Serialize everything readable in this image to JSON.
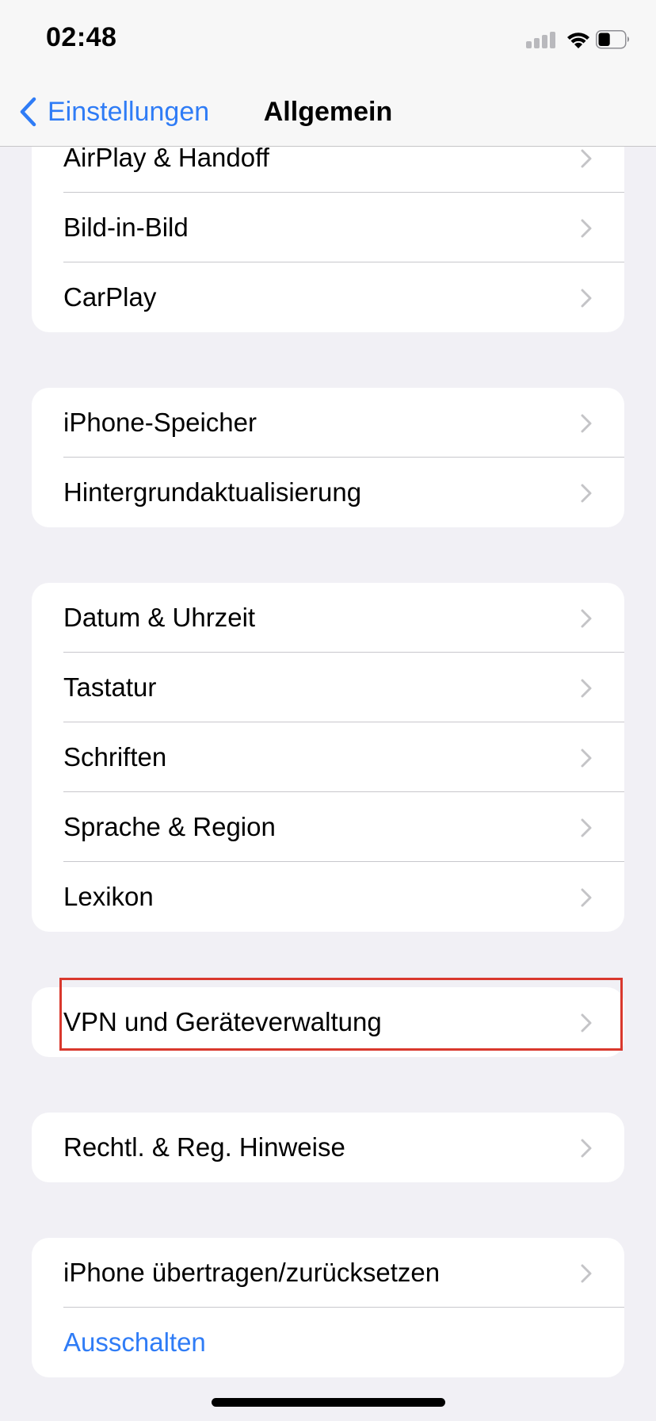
{
  "status_bar": {
    "time": "02:48",
    "signal_icon": "cellular-signal-icon",
    "wifi_icon": "wifi-icon",
    "battery_icon": "battery-icon",
    "battery_level": 0.45
  },
  "nav": {
    "back_label": "Einstellungen",
    "back_icon": "chevron-left-icon",
    "title": "Allgemein"
  },
  "groups": [
    {
      "items": [
        {
          "label": "AirPlay & Handoff"
        },
        {
          "label": "Bild-in-Bild"
        },
        {
          "label": "CarPlay"
        }
      ]
    },
    {
      "items": [
        {
          "label": "iPhone-Speicher"
        },
        {
          "label": "Hintergrundaktualisierung"
        }
      ]
    },
    {
      "items": [
        {
          "label": "Datum & Uhrzeit"
        },
        {
          "label": "Tastatur"
        },
        {
          "label": "Schriften"
        },
        {
          "label": "Sprache & Region"
        },
        {
          "label": "Lexikon"
        }
      ]
    },
    {
      "items": [
        {
          "label": "VPN und Geräteverwaltung",
          "highlighted": true
        }
      ]
    },
    {
      "items": [
        {
          "label": "Rechtl. & Reg. Hinweise"
        }
      ]
    },
    {
      "items": [
        {
          "label": "iPhone übertragen/zurücksetzen"
        },
        {
          "label": "Ausschalten",
          "style": "link"
        }
      ]
    }
  ],
  "colors": {
    "accent": "#2f7cf6",
    "background": "#f1f0f5",
    "highlight": "#d9382d",
    "chevron": "#c4c4c7"
  }
}
